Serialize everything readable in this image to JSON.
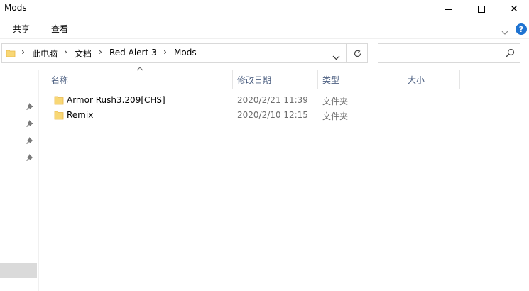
{
  "window": {
    "title": "Mods",
    "minimize_icon": "minimize-icon",
    "maximize_icon": "maximize-icon",
    "close_icon": "close-icon",
    "close_glyph": "✕"
  },
  "ribbon": {
    "tabs": [
      {
        "label": "共享"
      },
      {
        "label": "查看"
      }
    ],
    "expand_glyph": "⌄",
    "help_glyph": "?",
    "help_color": "#1e73d1"
  },
  "address_bar": {
    "breadcrumb": [
      "此电脑",
      "文档",
      "Red Alert 3",
      "Mods"
    ],
    "separator": "›"
  },
  "search": {
    "placeholder": ""
  },
  "columns": [
    {
      "label": "名称"
    },
    {
      "label": "修改日期"
    },
    {
      "label": "类型"
    },
    {
      "label": "大小"
    }
  ],
  "files": [
    {
      "name": "Armor Rush3.209[CHS]",
      "modified": "2020/2/21 11:39",
      "type": "文件夹",
      "size": ""
    },
    {
      "name": "Remix",
      "modified": "2020/2/10 12:15",
      "type": "文件夹",
      "size": ""
    }
  ],
  "colors": {
    "folder": "#f8d775",
    "folder_dark": "#e8b84a",
    "header_text": "#4d6082",
    "secondary_text": "#6d6d6d"
  }
}
